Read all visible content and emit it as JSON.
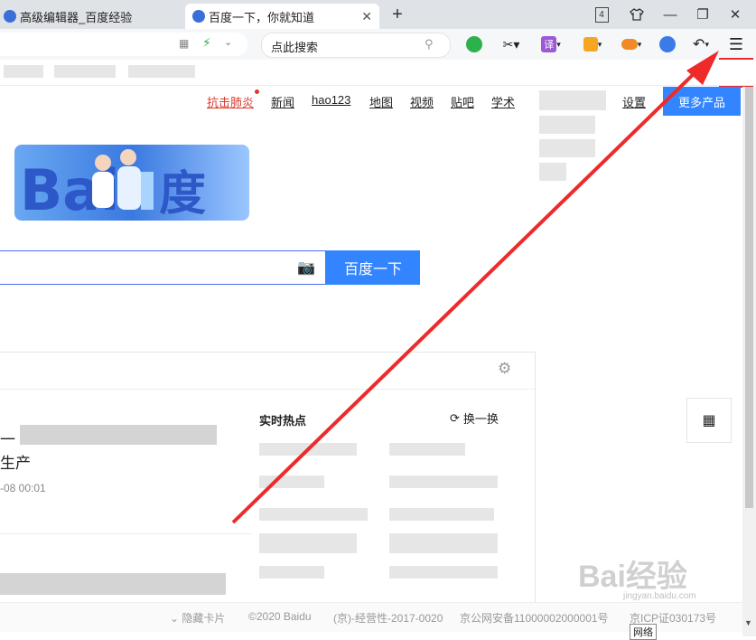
{
  "tabs": [
    {
      "title": "高级编辑器_百度经验",
      "active": false
    },
    {
      "title": "百度一下，你就知道",
      "active": true
    }
  ],
  "tab_close_glyph": "✕",
  "new_tab_glyph": "+",
  "window": {
    "tab_count": "4",
    "min": "—",
    "restore": "❐",
    "close": "✕"
  },
  "toolbar": {
    "search_placeholder": "点此搜索",
    "translate_label": "译",
    "menu_glyph": "☰"
  },
  "baidu_nav": {
    "items": [
      "抗击肺炎",
      "新闻",
      "hao123",
      "地图",
      "视频",
      "贴吧",
      "学术"
    ],
    "settings": "设置",
    "more_products": "更多产品"
  },
  "search": {
    "button_label": "百度一下"
  },
  "feed": {
    "headline_tail": "一",
    "headline_line2": "生产",
    "date": "-08 00:01",
    "hot_title": "实时热点",
    "refresh_label": "换一换"
  },
  "footer": {
    "hide_card": "隐藏卡片",
    "copyright": "©2020 Baidu",
    "license": "(京)-经营性-2017-0020",
    "security": "京公网安备11000002000001号",
    "icp": "京ICP证030173号"
  },
  "watermark": {
    "text": "Bai经验",
    "subtext": "jingyan.baidu.com"
  },
  "tooltip": "网络",
  "colors": {
    "accent_blue": "#3385ff",
    "annotation_red": "#ee2a2a",
    "hot_red": "#d9392e"
  }
}
